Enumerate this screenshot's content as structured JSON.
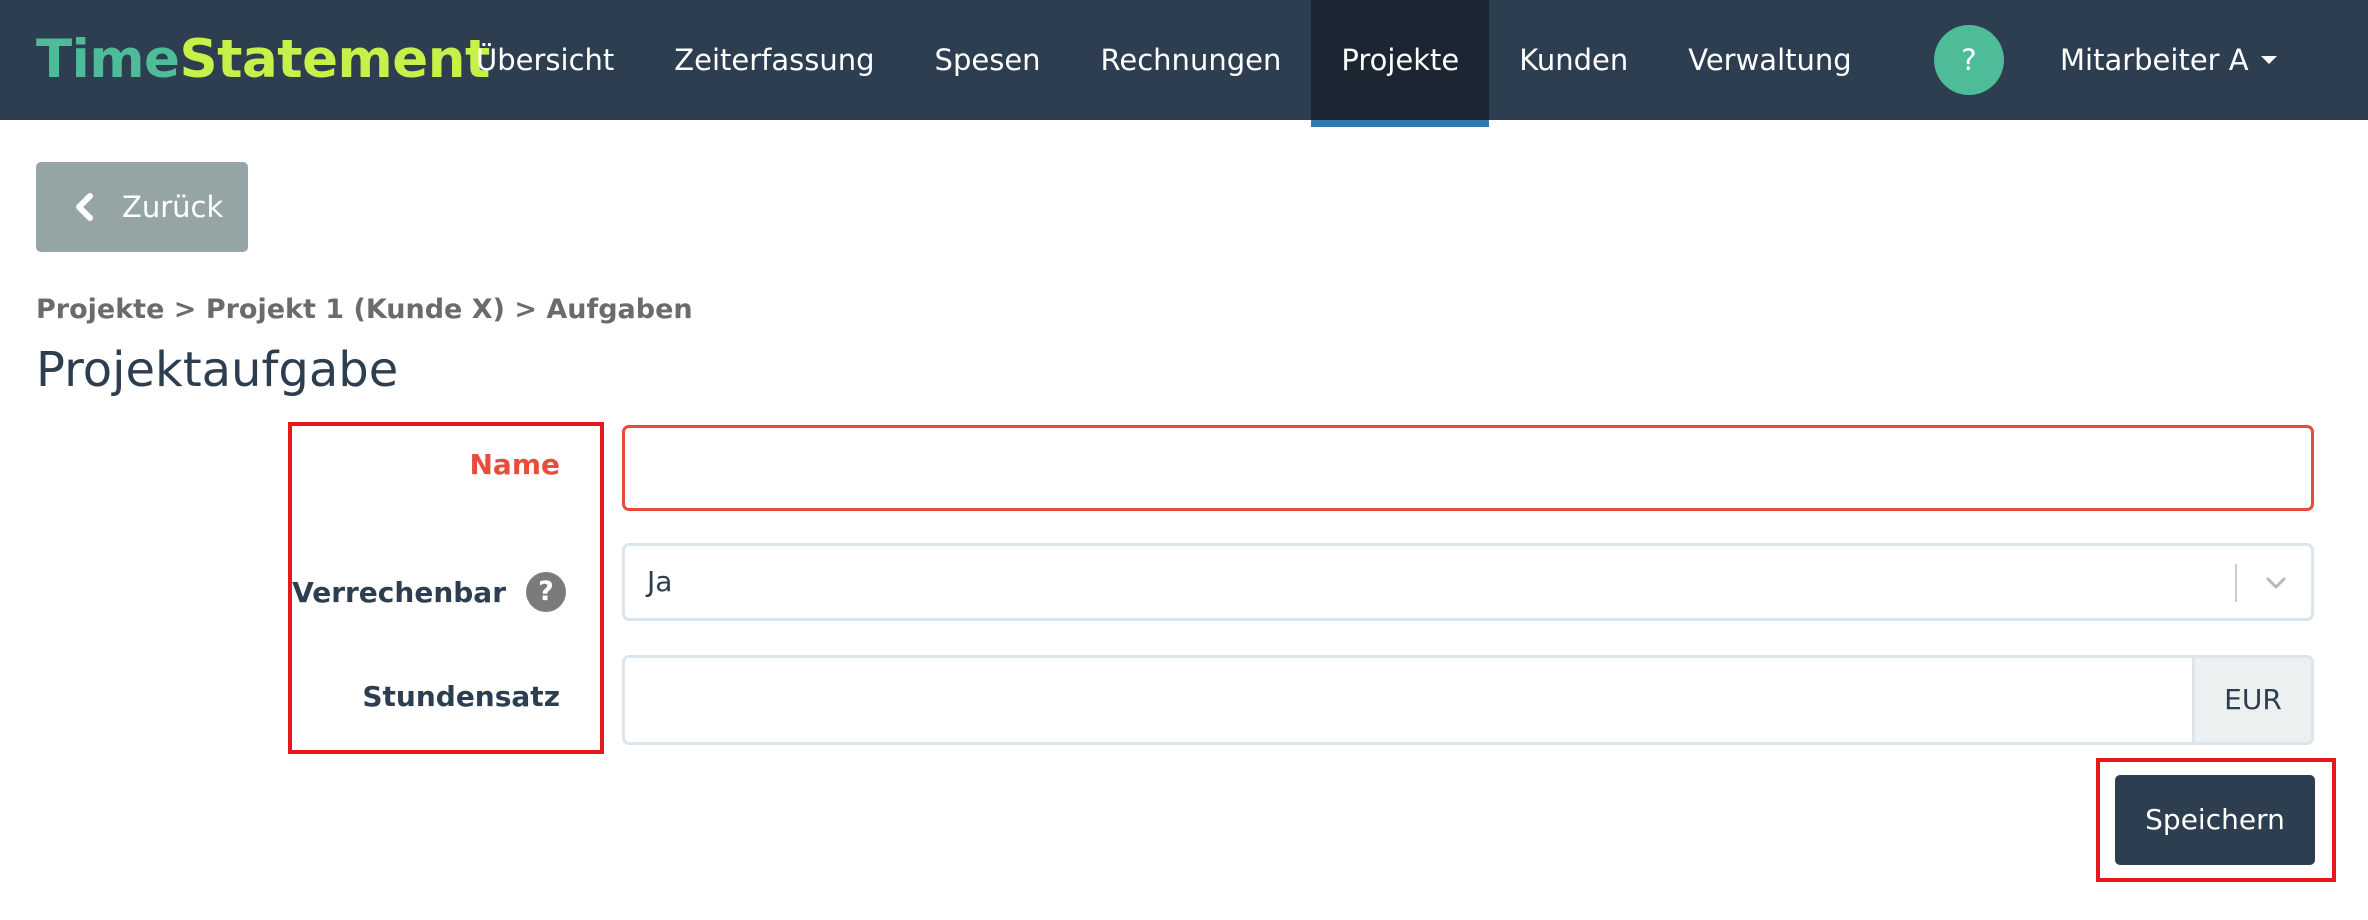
{
  "brand": {
    "part1": "Time",
    "part2": "Statement"
  },
  "nav": {
    "items": [
      {
        "label": "Übersicht"
      },
      {
        "label": "Zeiterfassung"
      },
      {
        "label": "Spesen"
      },
      {
        "label": "Rechnungen"
      },
      {
        "label": "Projekte",
        "active": true
      },
      {
        "label": "Kunden"
      },
      {
        "label": "Verwaltung"
      }
    ],
    "help_label": "?",
    "user_label": "Mitarbeiter A"
  },
  "back_button": {
    "label": "Zurück",
    "icon": "chevron-left-icon"
  },
  "breadcrumb": "Projekte > Projekt 1 (Kunde X) > Aufgaben",
  "page_title": "Projektaufgabe",
  "form": {
    "name": {
      "label": "Name",
      "value": "",
      "state": "error"
    },
    "verrechenbar": {
      "label": "Verrechenbar",
      "help": "?",
      "value": "Ja"
    },
    "stundensatz": {
      "label": "Stundensatz",
      "value": "",
      "addon": "EUR"
    },
    "save_label": "Speichern"
  },
  "colors": {
    "navbar": "#2c3e50",
    "brand_time": "#4ebc98",
    "brand_statement": "#c6f04a",
    "active_underline": "#2e7bb0",
    "error": "#e74c3c",
    "highlight_box": "#e8191c",
    "back_button": "#95a5a6",
    "help_button": "#4ebc98"
  }
}
